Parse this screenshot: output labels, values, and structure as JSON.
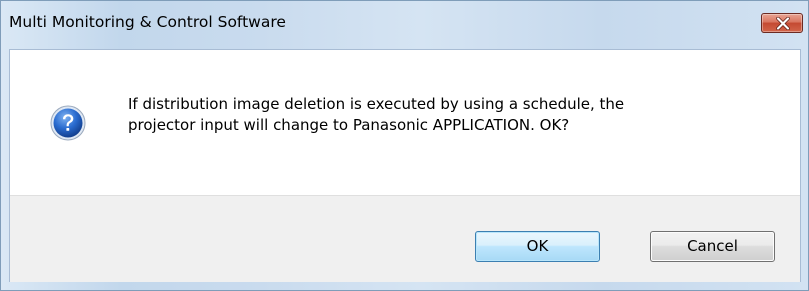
{
  "window": {
    "title": "Multi Monitoring & Control Software",
    "close_icon": "close-icon"
  },
  "message": {
    "icon": "question-icon",
    "line1": "If distribution image deletion is executed by using a schedule, the",
    "line2": "projector input will change to Panasonic APPLICATION. OK?"
  },
  "buttons": {
    "ok_label": "OK",
    "cancel_label": "Cancel"
  },
  "colors": {
    "title_bar": "#c9dbee",
    "close_button": "#c44a32",
    "question_icon": "#1f5db8",
    "ok_border": "#3c7fb1"
  }
}
